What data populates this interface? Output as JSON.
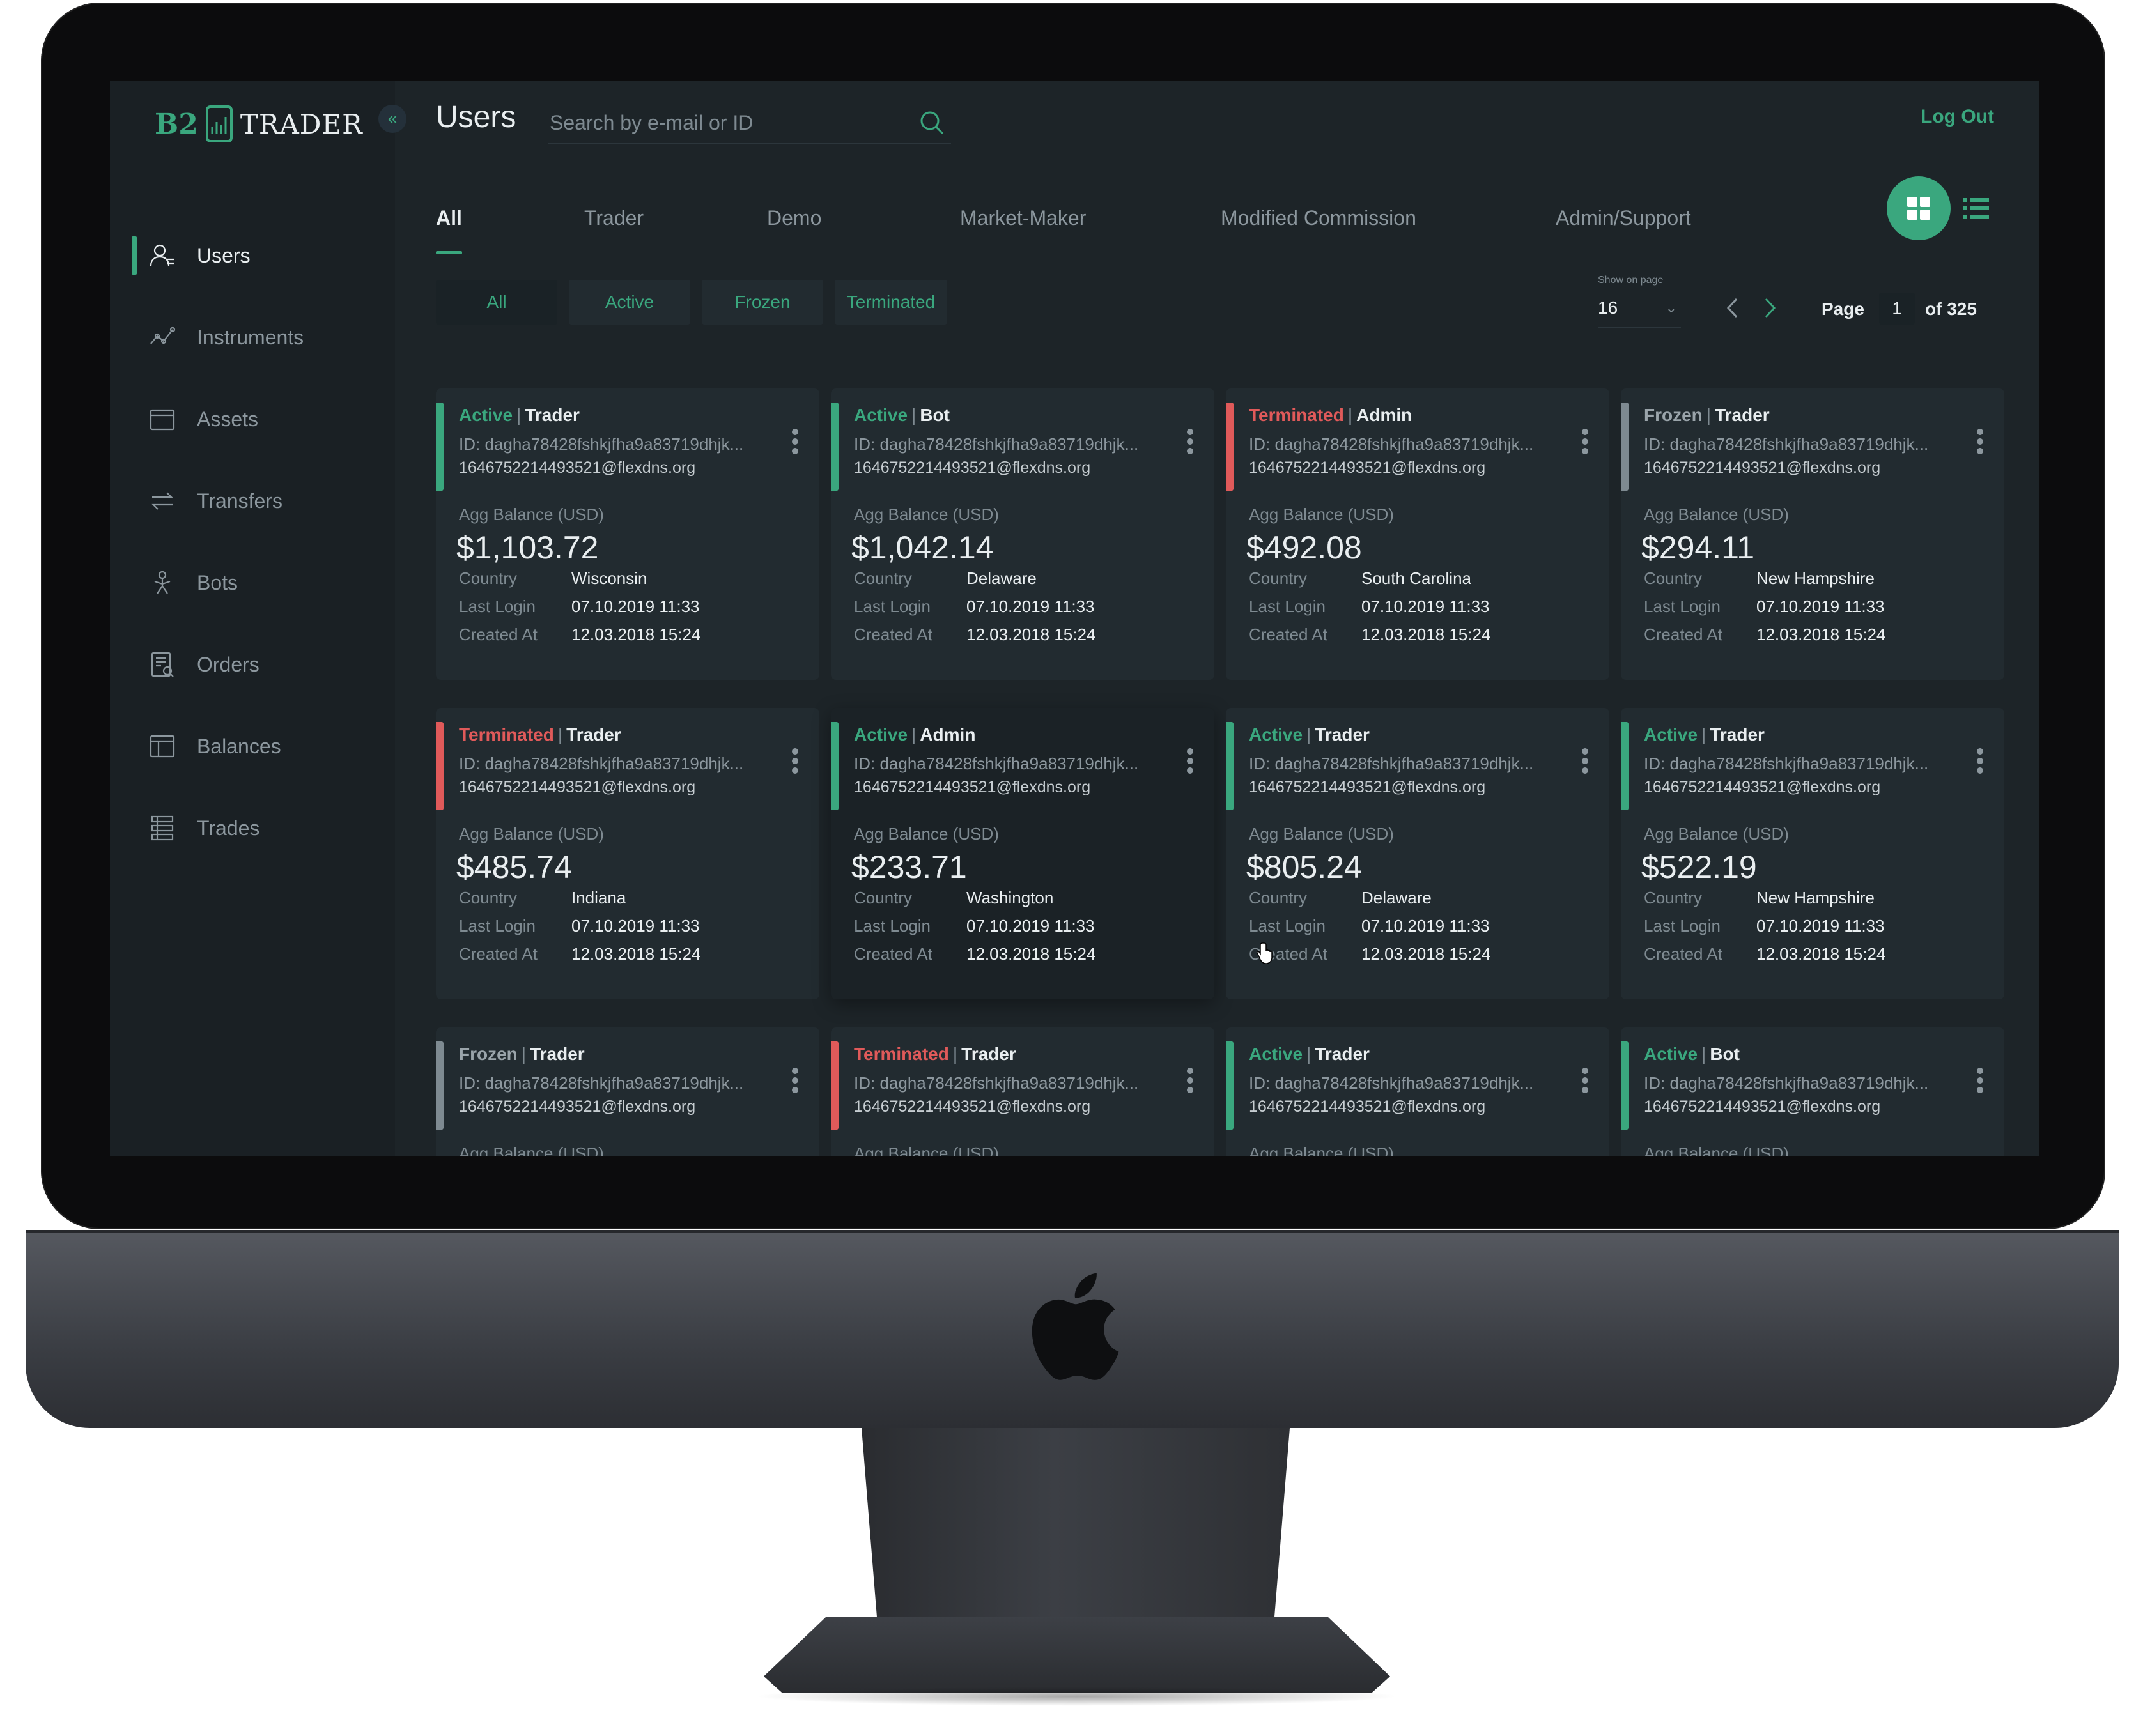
{
  "app": {
    "logo_b2": "B2",
    "logo_trader": "TRADER",
    "collapse_icon": "«",
    "page_title": "Users",
    "logout_label": "Log Out",
    "accent": "#3aa77e",
    "danger": "#e05a5a"
  },
  "search": {
    "placeholder": "Search by e-mail or ID",
    "value": ""
  },
  "sidebar": {
    "items": [
      {
        "label": "Users",
        "icon": "user-icon",
        "active": true
      },
      {
        "label": "Instruments",
        "icon": "chart-line-icon",
        "active": false
      },
      {
        "label": "Assets",
        "icon": "wallet-icon",
        "active": false
      },
      {
        "label": "Transfers",
        "icon": "transfer-icon",
        "active": false
      },
      {
        "label": "Bots",
        "icon": "robot-icon",
        "active": false
      },
      {
        "label": "Orders",
        "icon": "orders-icon",
        "active": false
      },
      {
        "label": "Balances",
        "icon": "balance-icon",
        "active": false
      },
      {
        "label": "Trades",
        "icon": "trades-icon",
        "active": false
      }
    ]
  },
  "tabs": [
    {
      "label": "All",
      "active": true
    },
    {
      "label": "Trader",
      "active": false
    },
    {
      "label": "Demo",
      "active": false
    },
    {
      "label": "Market-Maker",
      "active": false
    },
    {
      "label": "Modified Commission",
      "active": false
    },
    {
      "label": "Admin/Support",
      "active": false
    }
  ],
  "filters": [
    {
      "label": "All",
      "active": true
    },
    {
      "label": "Active",
      "active": false
    },
    {
      "label": "Frozen",
      "active": false
    },
    {
      "label": "Terminated",
      "active": false
    }
  ],
  "pagination": {
    "show_on_page_label": "Show on page",
    "per_page": "16",
    "page_label": "Page",
    "page": "1",
    "of_label": "of 325"
  },
  "card_labels": {
    "balance": "Agg Balance (USD)",
    "country": "Country",
    "last_login": "Last Login",
    "created_at": "Created At",
    "separator": "|"
  },
  "cards": [
    {
      "status": "Active",
      "role": "Trader",
      "id": "ID: dagha78428fshkjfha9a83719dhjk...",
      "email": "1646752214493521@flexdns.org",
      "balance": "$1,103.72",
      "country": "Wisconsin",
      "last_login": "07.10.2019 11:33",
      "created_at": "12.03.2018 15:24"
    },
    {
      "status": "Active",
      "role": "Bot",
      "id": "ID: dagha78428fshkjfha9a83719dhjk...",
      "email": "1646752214493521@flexdns.org",
      "balance": "$1,042.14",
      "country": "Delaware",
      "last_login": "07.10.2019 11:33",
      "created_at": "12.03.2018 15:24"
    },
    {
      "status": "Terminated",
      "role": "Admin",
      "id": "ID: dagha78428fshkjfha9a83719dhjk...",
      "email": "1646752214493521@flexdns.org",
      "balance": "$492.08",
      "country": "South Carolina",
      "last_login": "07.10.2019 11:33",
      "created_at": "12.03.2018 15:24"
    },
    {
      "status": "Frozen",
      "role": "Trader",
      "id": "ID: dagha78428fshkjfha9a83719dhjk...",
      "email": "1646752214493521@flexdns.org",
      "balance": "$294.11",
      "country": "New Hampshire",
      "last_login": "07.10.2019 11:33",
      "created_at": "12.03.2018 15:24"
    },
    {
      "status": "Terminated",
      "role": "Trader",
      "id": "ID: dagha78428fshkjfha9a83719dhjk...",
      "email": "1646752214493521@flexdns.org",
      "balance": "$485.74",
      "country": "Indiana",
      "last_login": "07.10.2019 11:33",
      "created_at": "12.03.2018 15:24"
    },
    {
      "status": "Active",
      "role": "Admin",
      "id": "ID: dagha78428fshkjfha9a83719dhjk...",
      "email": "1646752214493521@flexdns.org",
      "balance": "$233.71",
      "country": "Washington",
      "last_login": "07.10.2019 11:33",
      "created_at": "12.03.2018 15:24"
    },
    {
      "status": "Active",
      "role": "Trader",
      "id": "ID: dagha78428fshkjfha9a83719dhjk...",
      "email": "1646752214493521@flexdns.org",
      "balance": "$805.24",
      "country": "Delaware",
      "last_login": "07.10.2019 11:33",
      "created_at": "12.03.2018 15:24"
    },
    {
      "status": "Active",
      "role": "Trader",
      "id": "ID: dagha78428fshkjfha9a83719dhjk...",
      "email": "1646752214493521@flexdns.org",
      "balance": "$522.19",
      "country": "New Hampshire",
      "last_login": "07.10.2019 11:33",
      "created_at": "12.03.2018 15:24"
    },
    {
      "status": "Frozen",
      "role": "Trader",
      "id": "ID: dagha78428fshkjfha9a83719dhjk...",
      "email": "1646752214493521@flexdns.org"
    },
    {
      "status": "Terminated",
      "role": "Trader",
      "id": "ID: dagha78428fshkjfha9a83719dhjk...",
      "email": "1646752214493521@flexdns.org"
    },
    {
      "status": "Active",
      "role": "Trader",
      "id": "ID: dagha78428fshkjfha9a83719dhjk...",
      "email": "1646752214493521@flexdns.org"
    },
    {
      "status": "Active",
      "role": "Bot",
      "id": "ID: dagha78428fshkjfha9a83719dhjk...",
      "email": "1646752214493521@flexdns.org"
    }
  ]
}
